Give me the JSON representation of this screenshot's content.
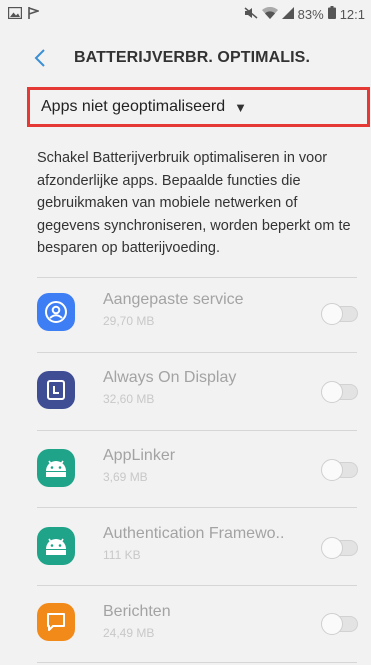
{
  "status_bar": {
    "battery_percent": "83%",
    "time": "12:1"
  },
  "header": {
    "title": "BATTERIJVERBR. OPTIMALIS."
  },
  "filter": {
    "label": "Apps niet geoptimaliseerd"
  },
  "description": "Schakel Batterijverbruik optimaliseren in voor afzonderlijke apps. Bepaalde functies die gebruikmaken van mobiele netwerken of gegevens synchroniseren, worden beperkt om te besparen op batterijvoeding.",
  "apps": [
    {
      "name": "Aangepaste service",
      "size": "29,70 MB",
      "icon": "service-icon",
      "color": "#3d7ef5",
      "optimized": false
    },
    {
      "name": "Always On Display",
      "size": "32,60 MB",
      "icon": "always-on-display-icon",
      "color": "#3f4e94",
      "optimized": false
    },
    {
      "name": "AppLinker",
      "size": "3,69 MB",
      "icon": "android-icon",
      "color": "#1fa489",
      "optimized": false
    },
    {
      "name": "Authentication Framewo..",
      "size": "111 KB",
      "icon": "android-icon",
      "color": "#1fa489",
      "optimized": false
    },
    {
      "name": "Berichten",
      "size": "24,49 MB",
      "icon": "message-icon",
      "color": "#f28a1a",
      "optimized": false
    }
  ],
  "colors": {
    "background": "#f2f2f2",
    "accent_back": "#3b8fd6",
    "highlight_border": "#e53935"
  }
}
